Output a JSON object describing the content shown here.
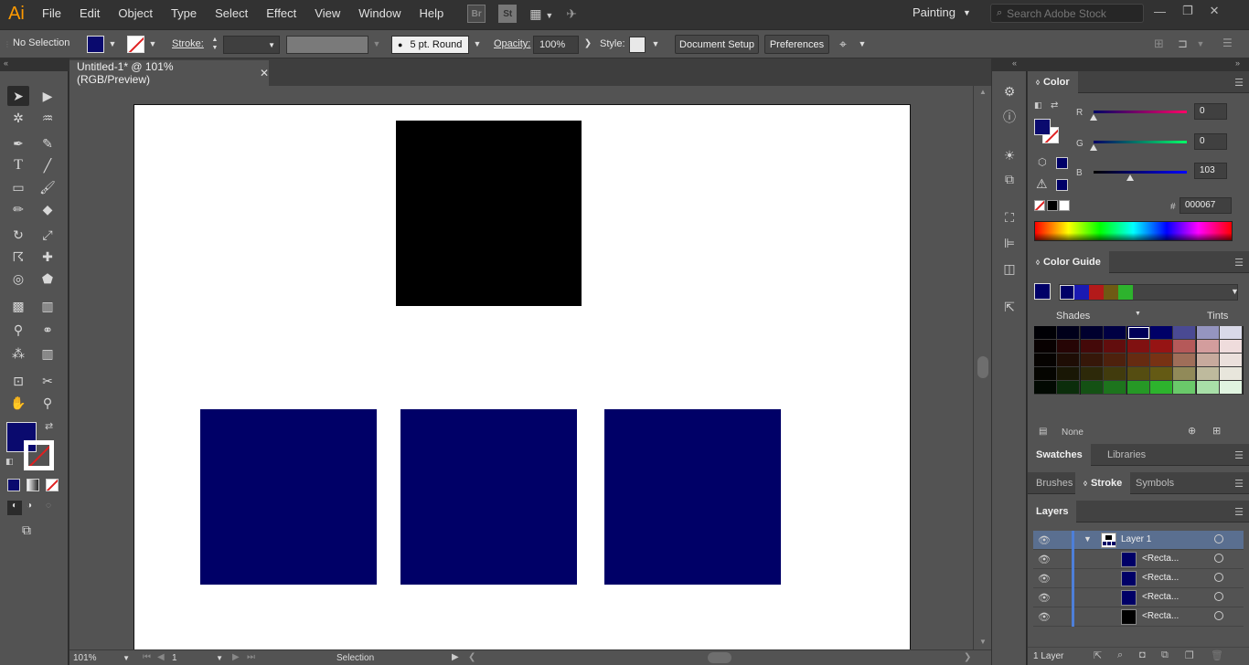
{
  "app": {
    "logo": "Ai"
  },
  "menu": [
    "File",
    "Edit",
    "Object",
    "Type",
    "Select",
    "Effect",
    "View",
    "Window",
    "Help"
  ],
  "menu_badges": {
    "bridge": "Br",
    "stock": "St"
  },
  "workspace": {
    "label": "Painting"
  },
  "stock_search": {
    "placeholder": "Search Adobe Stock"
  },
  "control_bar": {
    "selection_state": "No Selection",
    "stroke_label": "Stroke:",
    "brush_value": "5 pt. Round",
    "opacity_label": "Opacity:",
    "opacity_value": "100%",
    "style_label": "Style:",
    "document_setup": "Document Setup",
    "preferences": "Preferences",
    "fill_color": "#0a0a6e"
  },
  "document": {
    "tab_title": "Untitled-1* @ 101% (RGB/Preview)",
    "zoom": "101%",
    "artboard_number": "1",
    "status": "Selection"
  },
  "colors": {
    "fill": "#0a0a6e",
    "black_rect": "#000000",
    "navy_rect": "#000067"
  },
  "color_panel": {
    "title": "Color",
    "r_label": "R",
    "r_value": "0",
    "g_label": "G",
    "g_value": "0",
    "b_label": "B",
    "b_value": "103",
    "hash": "#",
    "hex_value": "000067"
  },
  "color_guide": {
    "title": "Color Guide",
    "shades_label": "Shades",
    "tints_label": "Tints",
    "none_label": "None",
    "harmony": [
      "#000067",
      "#1a1ab3",
      "#b31a1a",
      "#6e5a14",
      "#2db32d"
    ]
  },
  "panel_tabs": {
    "swatches": "Swatches",
    "libraries": "Libraries",
    "brushes": "Brushes",
    "stroke": "Stroke",
    "symbols": "Symbols",
    "layers": "Layers"
  },
  "layers": {
    "count_label": "1 Layer",
    "items": [
      {
        "name": "Layer 1",
        "color": "#ffffff"
      },
      {
        "name": "<Recta...",
        "color": "#000067"
      },
      {
        "name": "<Recta...",
        "color": "#000067"
      },
      {
        "name": "<Recta...",
        "color": "#000067"
      },
      {
        "name": "<Recta...",
        "color": "#000000"
      }
    ]
  }
}
